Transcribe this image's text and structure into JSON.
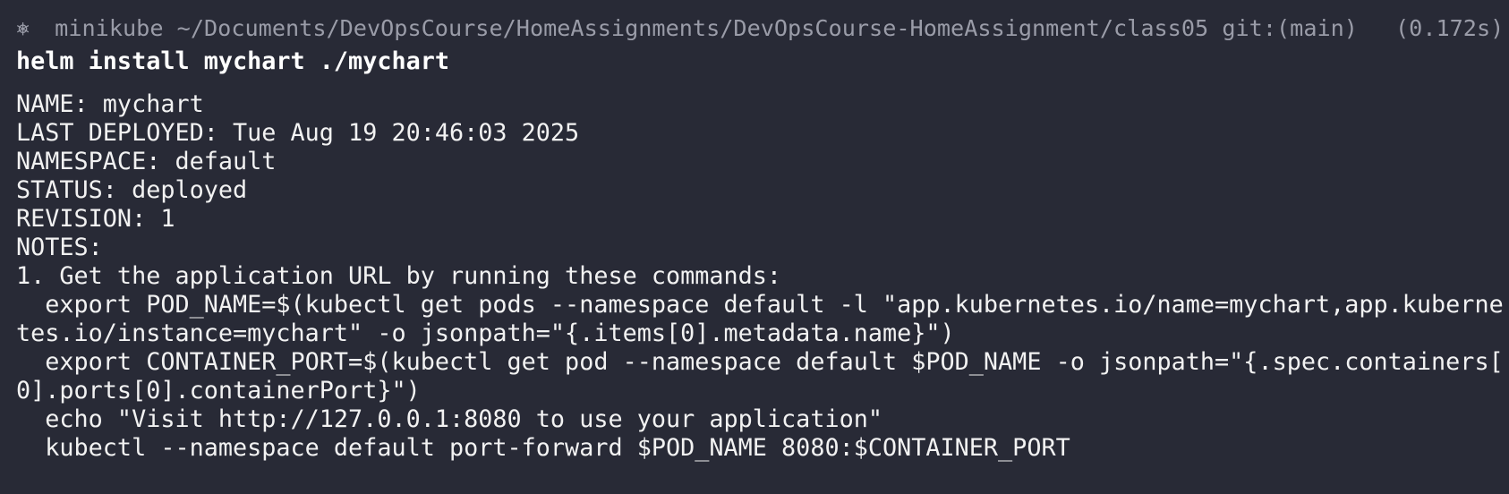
{
  "prompt": {
    "icon": "kubernetes-icon",
    "icon_glyph": "⎈",
    "context": "minikube",
    "path": "~/Documents/DevOpsCourse/HomeAssignments/DevOpsCourse-HomeAssignment/class05",
    "git": "git:(main)",
    "duration": "(0.172s)"
  },
  "command": "helm install mychart ./mychart",
  "output_lines": [
    "NAME: mychart",
    "LAST DEPLOYED: Tue Aug 19 20:46:03 2025",
    "NAMESPACE: default",
    "STATUS: deployed",
    "REVISION: 1",
    "NOTES:",
    "1. Get the application URL by running these commands:",
    "  export POD_NAME=$(kubectl get pods --namespace default -l \"app.kubernetes.io/name=mychart,app.kuberne",
    "tes.io/instance=mychart\" -o jsonpath=\"{.items[0].metadata.name}\")",
    "  export CONTAINER_PORT=$(kubectl get pod --namespace default $POD_NAME -o jsonpath=\"{.spec.containers[",
    "0].ports[0].containerPort}\")",
    "  echo \"Visit http://127.0.0.1:8080 to use your application\"",
    "  kubectl --namespace default port-forward $POD_NAME 8080:$CONTAINER_PORT"
  ],
  "colors": {
    "background": "#282a36",
    "prompt_text": "#9a9ca8",
    "command_text": "#ffffff",
    "output_text": "#f2f2f2"
  }
}
